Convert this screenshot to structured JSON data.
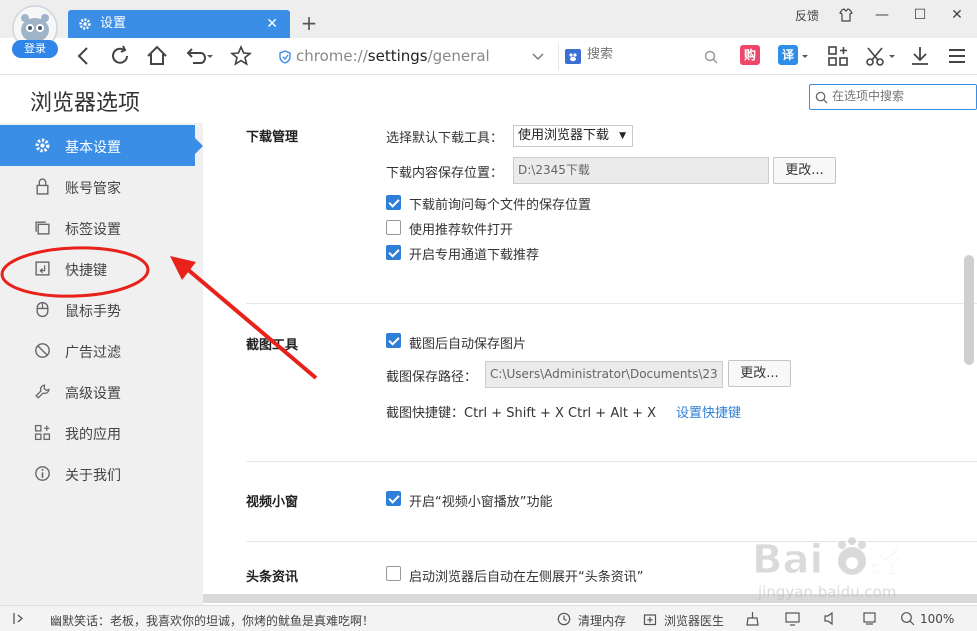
{
  "window": {
    "login_label": "登录",
    "tab_title": "设置",
    "new_tab": "+",
    "feedback": "反馈",
    "minimize": "—",
    "maximize": "☐",
    "close": "✕"
  },
  "toolbar": {
    "url_prefix": "chrome://",
    "url_host": "settings",
    "url_path": "/general",
    "search_placeholder": "搜索",
    "ext_gou": "购",
    "ext_yi": "译"
  },
  "header": {
    "title": "浏览器选项",
    "search_placeholder": "在选项中搜索"
  },
  "sidebar": {
    "items": [
      {
        "label": "基本设置",
        "icon": "gear-icon",
        "active": true
      },
      {
        "label": "账号管家",
        "icon": "lock-icon"
      },
      {
        "label": "标签设置",
        "icon": "tabs-icon"
      },
      {
        "label": "快捷键",
        "icon": "shortcut-icon"
      },
      {
        "label": "鼠标手势",
        "icon": "mouse-icon"
      },
      {
        "label": "广告过滤",
        "icon": "block-icon"
      },
      {
        "label": "高级设置",
        "icon": "wrench-icon"
      },
      {
        "label": "我的应用",
        "icon": "apps-icon"
      },
      {
        "label": "关于我们",
        "icon": "info-icon"
      }
    ]
  },
  "download": {
    "section_title": "下载管理",
    "default_tool_label": "选择默认下载工具：",
    "default_tool_value": "使用浏览器下载",
    "save_path_label": "下载内容保存位置：",
    "save_path_value": "D:\\2345下载",
    "change_button": "更改...",
    "opt_ask_each": "下载前询问每个文件的保存位置",
    "opt_ask_each_checked": true,
    "opt_recommended": "使用推荐软件打开",
    "opt_recommended_checked": false,
    "opt_channel": "开启专用通道下载推荐",
    "opt_channel_checked": true
  },
  "screenshot": {
    "section_title": "截图工具",
    "opt_autosave": "截图后自动保存图片",
    "opt_autosave_checked": true,
    "path_label": "截图保存路径：",
    "path_value": "C:\\Users\\Administrator\\Documents\\23",
    "change_button": "更改...",
    "shortcut_label": "截图快捷键：Ctrl + Shift + X  Ctrl + Alt + X",
    "shortcut_link": "设置快捷键"
  },
  "video": {
    "section_title": "视频小窗",
    "opt_label": "开启“视频小窗播放”功能",
    "opt_checked": true
  },
  "news": {
    "section_title": "头条资讯",
    "opt_label": "启动浏览器后自动在左侧展开“头条资讯”",
    "opt_checked": false
  },
  "statusbar": {
    "joke": "幽默笑话：老板，我喜欢你的坦诚，你烤的鱿鱼是真难吃啊！",
    "clean_memory": "清理内存",
    "doctor": "浏览器医生",
    "zoom": "100%"
  },
  "watermark": {
    "brand": "Bai",
    "brand_tail": "经验",
    "url": "jingyan.baidu.com"
  },
  "colors": {
    "accent": "#3b8ee6",
    "annotation": "#e8221b"
  }
}
